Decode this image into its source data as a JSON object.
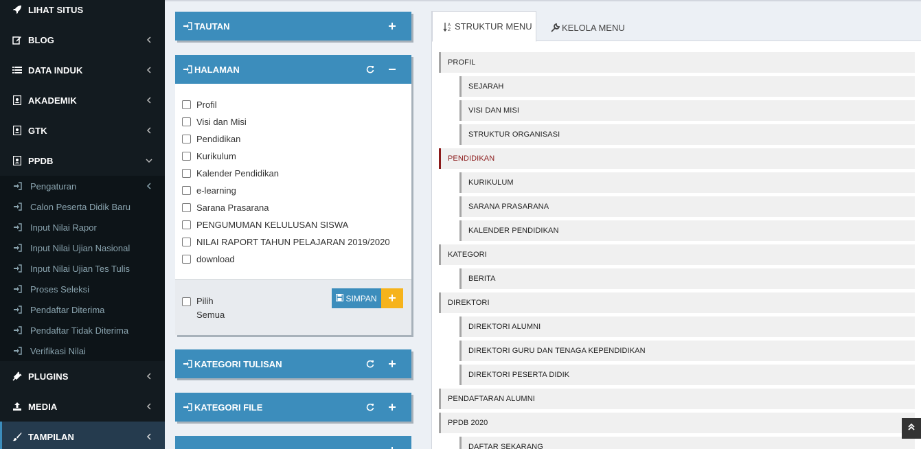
{
  "sidebar": {
    "items": [
      {
        "label": "LIHAT SITUS",
        "icon": "rocket-icon"
      },
      {
        "label": "BLOG",
        "icon": "edit-icon"
      },
      {
        "label": "DATA INDUK",
        "icon": "list-icon"
      },
      {
        "label": "AKADEMIK",
        "icon": "id-card-icon"
      },
      {
        "label": "GTK",
        "icon": "id-card-icon"
      },
      {
        "label": "PPDB",
        "icon": "id-card-icon"
      },
      {
        "label": "PLUGINS",
        "icon": "plug-icon"
      },
      {
        "label": "MEDIA",
        "icon": "upload-icon"
      },
      {
        "label": "TAMPILAN",
        "icon": "brush-icon"
      }
    ],
    "ppdb_submenu": [
      "Pengaturan",
      "Calon Peserta Didik Baru",
      "Input Nilai Rapor",
      "Input Nilai Ujian Nasional",
      "Input Nilai Ujian Tes Tulis",
      "Proses Seleksi",
      "Pendaftar Diterima",
      "Pendaftar Tidak Diterima",
      "Verifikasi Nilai"
    ]
  },
  "boxes": {
    "tautan": {
      "title": "TAUTAN"
    },
    "halaman": {
      "title": "HALAMAN",
      "pages": [
        "Profil",
        "Visi dan Misi",
        "Pendidikan",
        "Kurikulum",
        "Kalender Pendidikan",
        "e-learning",
        "Sarana Prasarana",
        "PENGUMUMAN KELULUSAN SISWA",
        "NILAI RAPORT TAHUN PELAJARAN 2019/2020",
        "download"
      ],
      "select_all_line1": "Pilih",
      "select_all_line2": "Semua",
      "save_label": "SIMPAN"
    },
    "kategori_tulisan": {
      "title": "KATEGORI TULISAN"
    },
    "kategori_file": {
      "title": "KATEGORI FILE"
    }
  },
  "tabs": {
    "struktur": "STRUKTUR MENU",
    "kelola": "KELOLA MENU"
  },
  "menu_tree": [
    {
      "label": "PROFIL",
      "level": 0
    },
    {
      "label": "SEJARAH",
      "level": 1
    },
    {
      "label": "VISI DAN MISI",
      "level": 1
    },
    {
      "label": "STRUKTUR ORGANISASI",
      "level": 1
    },
    {
      "label": "PENDIDIKAN",
      "level": 0
    },
    {
      "label": "KURIKULUM",
      "level": 1
    },
    {
      "label": "SARANA PRASARANA",
      "level": 1
    },
    {
      "label": "KALENDER PENDIDIKAN",
      "level": 1
    },
    {
      "label": "KATEGORI",
      "level": 0
    },
    {
      "label": "BERITA",
      "level": 1
    },
    {
      "label": "DIREKTORI",
      "level": 0
    },
    {
      "label": "DIREKTORI ALUMNI",
      "level": 1
    },
    {
      "label": "DIREKTORI GURU DAN TENAGA KEPENDIDIKAN",
      "level": 1
    },
    {
      "label": "DIREKTORI PESERTA DIDIK",
      "level": 1
    },
    {
      "label": "PENDAFTARAN ALUMNI",
      "level": 0
    },
    {
      "label": "PPDB 2020",
      "level": 0
    },
    {
      "label": "DAFTAR SEKARANG",
      "level": 1
    }
  ],
  "colors": {
    "primary": "#3c8dbc",
    "warning": "#f6b31c",
    "sidebar_bg": "#131b20",
    "active_menu_border": "#8b1a1a"
  }
}
